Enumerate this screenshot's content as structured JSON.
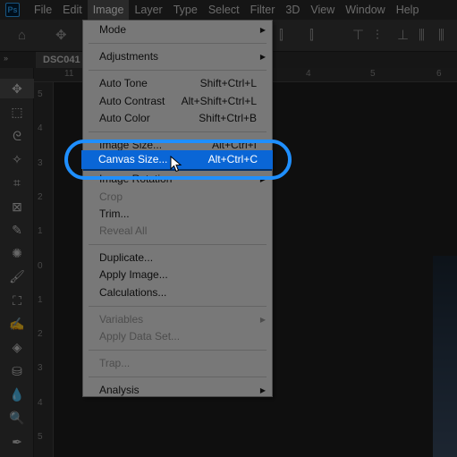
{
  "app": {
    "logo_text": "Ps"
  },
  "menubar": {
    "items": [
      {
        "label": "File"
      },
      {
        "label": "Edit"
      },
      {
        "label": "Image",
        "active": true
      },
      {
        "label": "Layer"
      },
      {
        "label": "Type"
      },
      {
        "label": "Select"
      },
      {
        "label": "Filter"
      },
      {
        "label": "3D"
      },
      {
        "label": "View"
      },
      {
        "label": "Window"
      },
      {
        "label": "Help"
      }
    ]
  },
  "document": {
    "tab_label": "DSC041"
  },
  "toolbar": {
    "tools": [
      {
        "name": "move-tool-icon",
        "glyph": "✥",
        "selected": true
      },
      {
        "name": "marquee-tool-icon",
        "glyph": "⬚"
      },
      {
        "name": "lasso-tool-icon",
        "glyph": "ᘓ"
      },
      {
        "name": "magic-wand-tool-icon",
        "glyph": "✧"
      },
      {
        "name": "crop-tool-icon",
        "glyph": "⌗"
      },
      {
        "name": "frame-tool-icon",
        "glyph": "⊠"
      },
      {
        "name": "eyedropper-tool-icon",
        "glyph": "✎"
      },
      {
        "name": "spot-healing-tool-icon",
        "glyph": "✺"
      },
      {
        "name": "brush-tool-icon",
        "glyph": "🖌"
      },
      {
        "name": "clone-stamp-tool-icon",
        "glyph": "⛶"
      },
      {
        "name": "history-brush-tool-icon",
        "glyph": "✍"
      },
      {
        "name": "eraser-tool-icon",
        "glyph": "◈"
      },
      {
        "name": "paint-bucket-tool-icon",
        "glyph": "⛁"
      },
      {
        "name": "blur-tool-icon",
        "glyph": "💧"
      },
      {
        "name": "dodge-tool-icon",
        "glyph": "🔍"
      },
      {
        "name": "pen-tool-icon",
        "glyph": "✒"
      }
    ]
  },
  "rulers": {
    "horizontal": [
      "11",
      "4",
      "5",
      "6"
    ],
    "vertical": [
      "5",
      "4",
      "3",
      "2",
      "1",
      "0",
      "1",
      "2",
      "3",
      "4",
      "5"
    ]
  },
  "image_menu": {
    "items": [
      {
        "label": "Mode",
        "submenu": true
      },
      {
        "separator": true
      },
      {
        "label": "Adjustments",
        "submenu": true
      },
      {
        "separator": true
      },
      {
        "label": "Auto Tone",
        "shortcut": "Shift+Ctrl+L"
      },
      {
        "label": "Auto Contrast",
        "shortcut": "Alt+Shift+Ctrl+L"
      },
      {
        "label": "Auto Color",
        "shortcut": "Shift+Ctrl+B"
      },
      {
        "separator": true
      },
      {
        "label": "Image Size...",
        "shortcut": "Alt+Ctrl+I"
      },
      {
        "label": "Canvas Size...",
        "shortcut": "Alt+Ctrl+C",
        "highlighted": true
      },
      {
        "label": "Image Rotation",
        "submenu": true
      },
      {
        "label": "Crop",
        "disabled": true
      },
      {
        "label": "Trim..."
      },
      {
        "label": "Reveal All",
        "disabled": true
      },
      {
        "separator": true
      },
      {
        "label": "Duplicate..."
      },
      {
        "label": "Apply Image..."
      },
      {
        "label": "Calculations..."
      },
      {
        "separator": true
      },
      {
        "label": "Variables",
        "submenu": true,
        "disabled": true
      },
      {
        "label": "Apply Data Set...",
        "disabled": true
      },
      {
        "separator": true
      },
      {
        "label": "Trap...",
        "disabled": true
      },
      {
        "separator": true
      },
      {
        "label": "Analysis",
        "submenu": true
      }
    ]
  },
  "colors": {
    "highlight": "#0a66d6",
    "callout_ring": "#1f8fff"
  }
}
